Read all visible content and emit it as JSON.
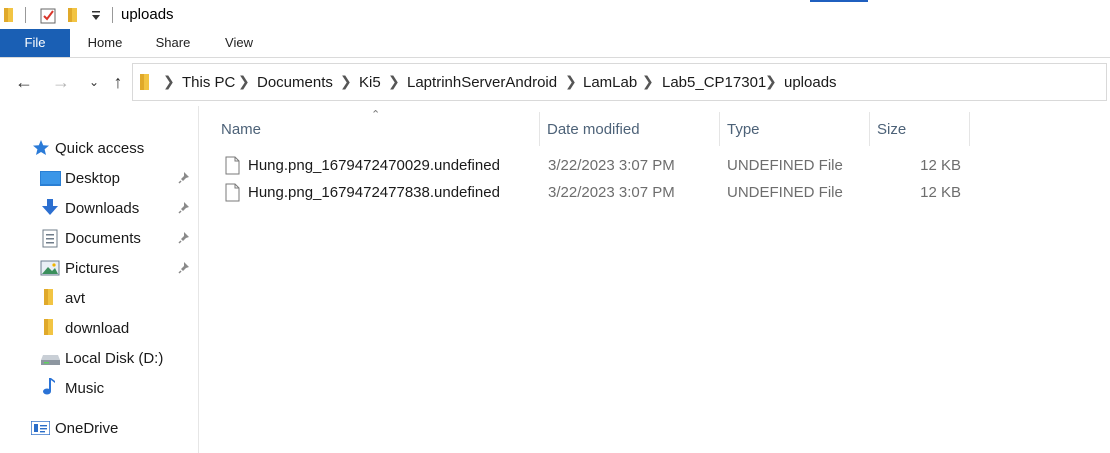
{
  "window": {
    "title": "uploads"
  },
  "ribbon": {
    "tabs": [
      {
        "label": "File"
      },
      {
        "label": "Home"
      },
      {
        "label": "Share"
      },
      {
        "label": "View"
      }
    ]
  },
  "breadcrumb": [
    "This PC",
    "Documents",
    "Ki5",
    "LaptrinhServerAndroid",
    "LamLab",
    "Lab5_CP17301",
    "uploads"
  ],
  "sidebar": {
    "items": [
      {
        "label": "Quick access",
        "icon": "star-icon"
      },
      {
        "label": "Desktop",
        "icon": "desktop-icon",
        "pinned": true
      },
      {
        "label": "Downloads",
        "icon": "download-arrow-icon",
        "pinned": true
      },
      {
        "label": "Documents",
        "icon": "document-icon",
        "pinned": true
      },
      {
        "label": "Pictures",
        "icon": "picture-icon",
        "pinned": true
      },
      {
        "label": "avt",
        "icon": "folder-icon"
      },
      {
        "label": "download",
        "icon": "folder-icon"
      },
      {
        "label": "Local Disk (D:)",
        "icon": "drive-icon"
      },
      {
        "label": "Music",
        "icon": "music-note-icon"
      },
      {
        "label": "OneDrive",
        "icon": "onedrive-icon"
      }
    ]
  },
  "columns": {
    "name": "Name",
    "date": "Date modified",
    "type": "Type",
    "size": "Size"
  },
  "files": [
    {
      "name": "Hung.png_1679472470029.undefined",
      "date": "3/22/2023 3:07 PM",
      "type": "UNDEFINED File",
      "size": "12 KB"
    },
    {
      "name": "Hung.png_1679472477838.undefined",
      "date": "3/22/2023 3:07 PM",
      "type": "UNDEFINED File",
      "size": "12 KB"
    }
  ],
  "colors": {
    "accent": "#1a5fb4",
    "folder": "#f4c542"
  }
}
